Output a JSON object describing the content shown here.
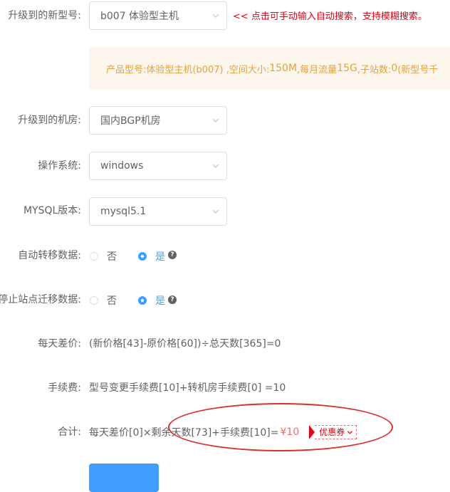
{
  "model": {
    "label": "升级到的新型号:",
    "value": "b007 体验型主机",
    "hint": "<< 点击可手动输入自动搜索，支持模糊搜索。"
  },
  "product_info": {
    "prefix": "产品型号:体验型主机(b007) ,空间大小:",
    "space": "150M",
    "mid1": " ,每月流量",
    "traffic": "15G",
    "mid2": " ,子站数:",
    "subsites": "0",
    "suffix": " (新型号千"
  },
  "room": {
    "label": "升级到的机房:",
    "value": "国内BGP机房"
  },
  "os": {
    "label": "操作系统:",
    "value": "windows"
  },
  "mysql": {
    "label": "MYSQL版本:",
    "value": "mysql5.1"
  },
  "auto_migrate": {
    "label": "自动转移数据:",
    "no": "否",
    "yes": "是",
    "selected": "yes"
  },
  "stop_site": {
    "label": "停止站点迁移数据:",
    "no": "否",
    "yes": "是",
    "selected": "yes"
  },
  "daily_diff": {
    "label": "每天差价:",
    "formula": "(新价格[43]-原价格[60])÷总天数[365]=0"
  },
  "fee": {
    "label": "手续费:",
    "formula": "型号变更手续费[10]+转机房手续费[0] =10"
  },
  "total": {
    "label": "合计:",
    "formula": "每天差价[0]×剩余天数[73]+手续费[10]=",
    "amount": "¥10",
    "coupon": "优惠券"
  },
  "colors": {
    "primary": "#409eff",
    "hint_red": "#e60012",
    "warning": "#e6a23c",
    "annotation": "#d9302c"
  }
}
